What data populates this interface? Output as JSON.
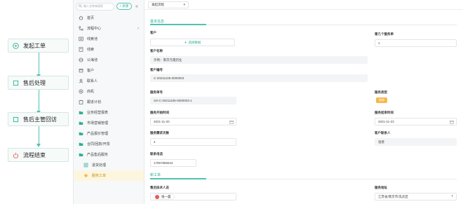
{
  "flow": {
    "steps": [
      {
        "label": "发起工单",
        "icon": "play-circle-icon"
      },
      {
        "label": "售后处理",
        "icon": "square-icon"
      },
      {
        "label": "售后主管回访",
        "icon": "square-icon"
      },
      {
        "label": "流程结束",
        "icon": "power-icon"
      }
    ],
    "accent": "#4fc3b0"
  },
  "sidebar": {
    "search_placeholder": "输入名称来搜索",
    "new_button": "+ 新建",
    "collapse": "«",
    "items": [
      {
        "label": "首页",
        "icon": "home-icon"
      },
      {
        "label": "流程中心",
        "icon": "flow-icon",
        "chevron": "›"
      },
      {
        "label": "线索池",
        "icon": "clue-pool-icon"
      },
      {
        "label": "线索",
        "icon": "clue-icon"
      },
      {
        "label": "公海池",
        "icon": "sea-pool-icon"
      },
      {
        "label": "客户",
        "icon": "customer-icon"
      },
      {
        "label": "联系人",
        "icon": "contact-icon"
      },
      {
        "label": "商机",
        "icon": "opportunity-icon"
      },
      {
        "label": "跟进计划",
        "icon": "plan-icon"
      },
      {
        "label": "业务经营报表",
        "icon": "folder-icon"
      },
      {
        "label": "市场营销管理",
        "icon": "folder-icon"
      },
      {
        "label": "产品报价管理",
        "icon": "folder-icon"
      },
      {
        "label": "合同/回款/开票",
        "icon": "folder-icon"
      },
      {
        "label": "产品售后服务",
        "icon": "folder-open-icon"
      },
      {
        "label": "退货处理",
        "icon": "return-icon"
      },
      {
        "label": "服务工单",
        "icon": "ticket-icon"
      }
    ]
  },
  "main": {
    "process_select": "发起流程",
    "section_basic": "基本信息",
    "section_new": "新工单",
    "customer_label": "客户",
    "customer_button": "选择数据",
    "customer_name_label": "客户名称",
    "customer_name": "示例：南京元霞药业",
    "customer_id_label": "客户编号",
    "customer_id": "C-20211105-0000003",
    "nth_service_label": "第几个服务单",
    "nth_service": "1",
    "service_no_label": "服务单号",
    "service_no": "SS-C-20211105-0000003-1",
    "service_type_label": "服务类型",
    "service_type": "保修",
    "start_label": "服务开始时间",
    "start": "2021-11-20",
    "end_label": "服务结束时间",
    "end": "2021-11-23",
    "days_label": "服务需求天数",
    "days": "4",
    "contact_label": "客户联系人",
    "contact": "张善",
    "phone_label": "联系电话",
    "phone": "17857856542",
    "tech_label": "售后技术人员",
    "tech": "张一晨",
    "address_label": "服务地址",
    "address": "江苏省/南京市/玄武区"
  }
}
